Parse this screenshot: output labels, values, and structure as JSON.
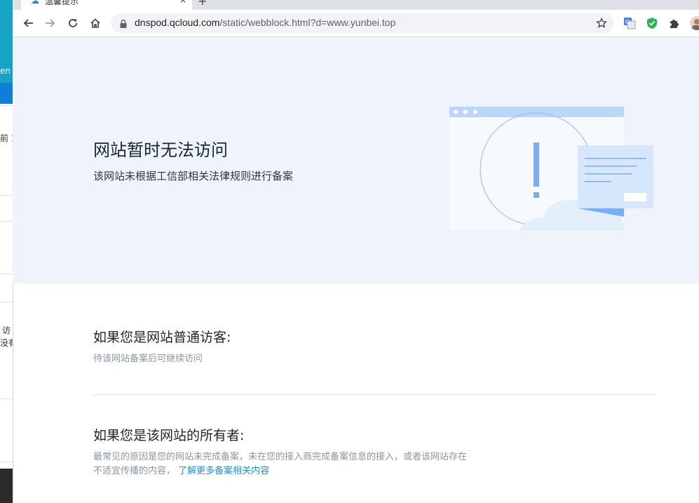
{
  "background_window": {
    "fragments": [
      "en",
      "前 1",
      "访",
      "没有"
    ]
  },
  "tab": {
    "title": "温馨提示",
    "close": "×",
    "new_tab": "+"
  },
  "toolbar": {
    "url_host": "dnspod.qcloud.com",
    "url_rest": "/static/webblock.html?d=www.yunbei.top"
  },
  "page": {
    "hero": {
      "title": "网站暂时无法访问",
      "subtitle": "该网站未根据工信部相关法律规则进行备案"
    },
    "visitor": {
      "heading": "如果您是网站普通访客:",
      "body": "待该网站备案后可继续访问"
    },
    "owner": {
      "heading": "如果您是该网站的所有者:",
      "body_line1": "最常见的原因是您的网站未完成备案，未在您的接入商完成备案信息的接入，或者该网站存在",
      "body_line2": "不适宜传播的内容，",
      "link": "了解更多备案相关内容"
    }
  },
  "colors": {
    "hero_bg": "#eff4fc",
    "link": "#1e8fe1",
    "accent_blue": "#78aef5"
  }
}
